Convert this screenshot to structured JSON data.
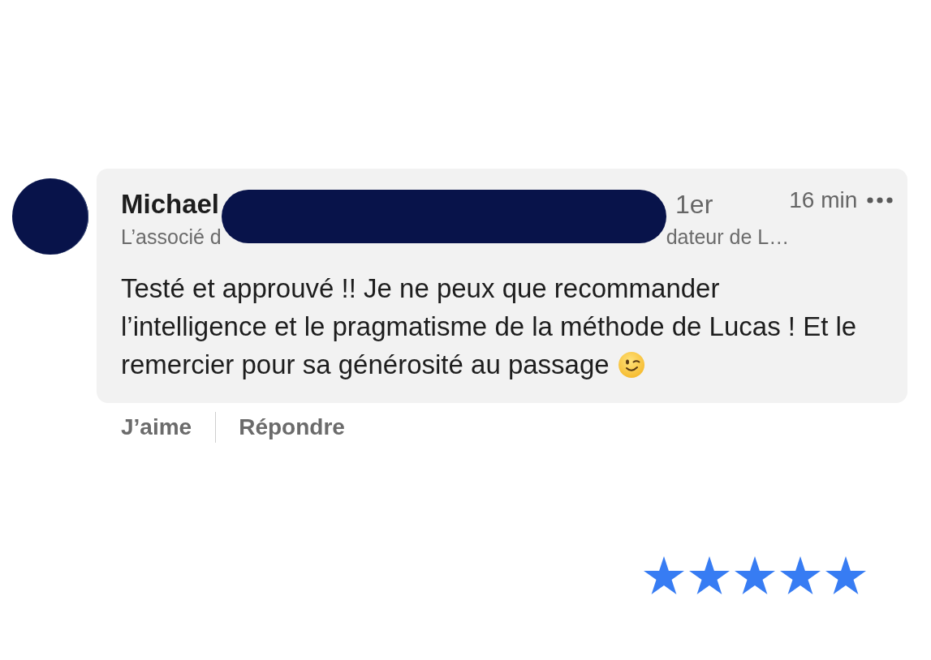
{
  "comment": {
    "author": "Michael",
    "connection_degree": "1er",
    "time": "16 min",
    "headline_start": "L’associé d",
    "headline_end": "dateur de L…",
    "body_lines": [
      "Testé et approuvé !! Je ne peux que recommander",
      "l’intelligence et le pragmatisme de la méthode de Lucas ! Et le",
      "remercier pour sa générosité au passage"
    ]
  },
  "actions": [
    {
      "label": "J’aime"
    },
    {
      "label": "Répondre"
    }
  ],
  "rating": {
    "stars": 5
  }
}
